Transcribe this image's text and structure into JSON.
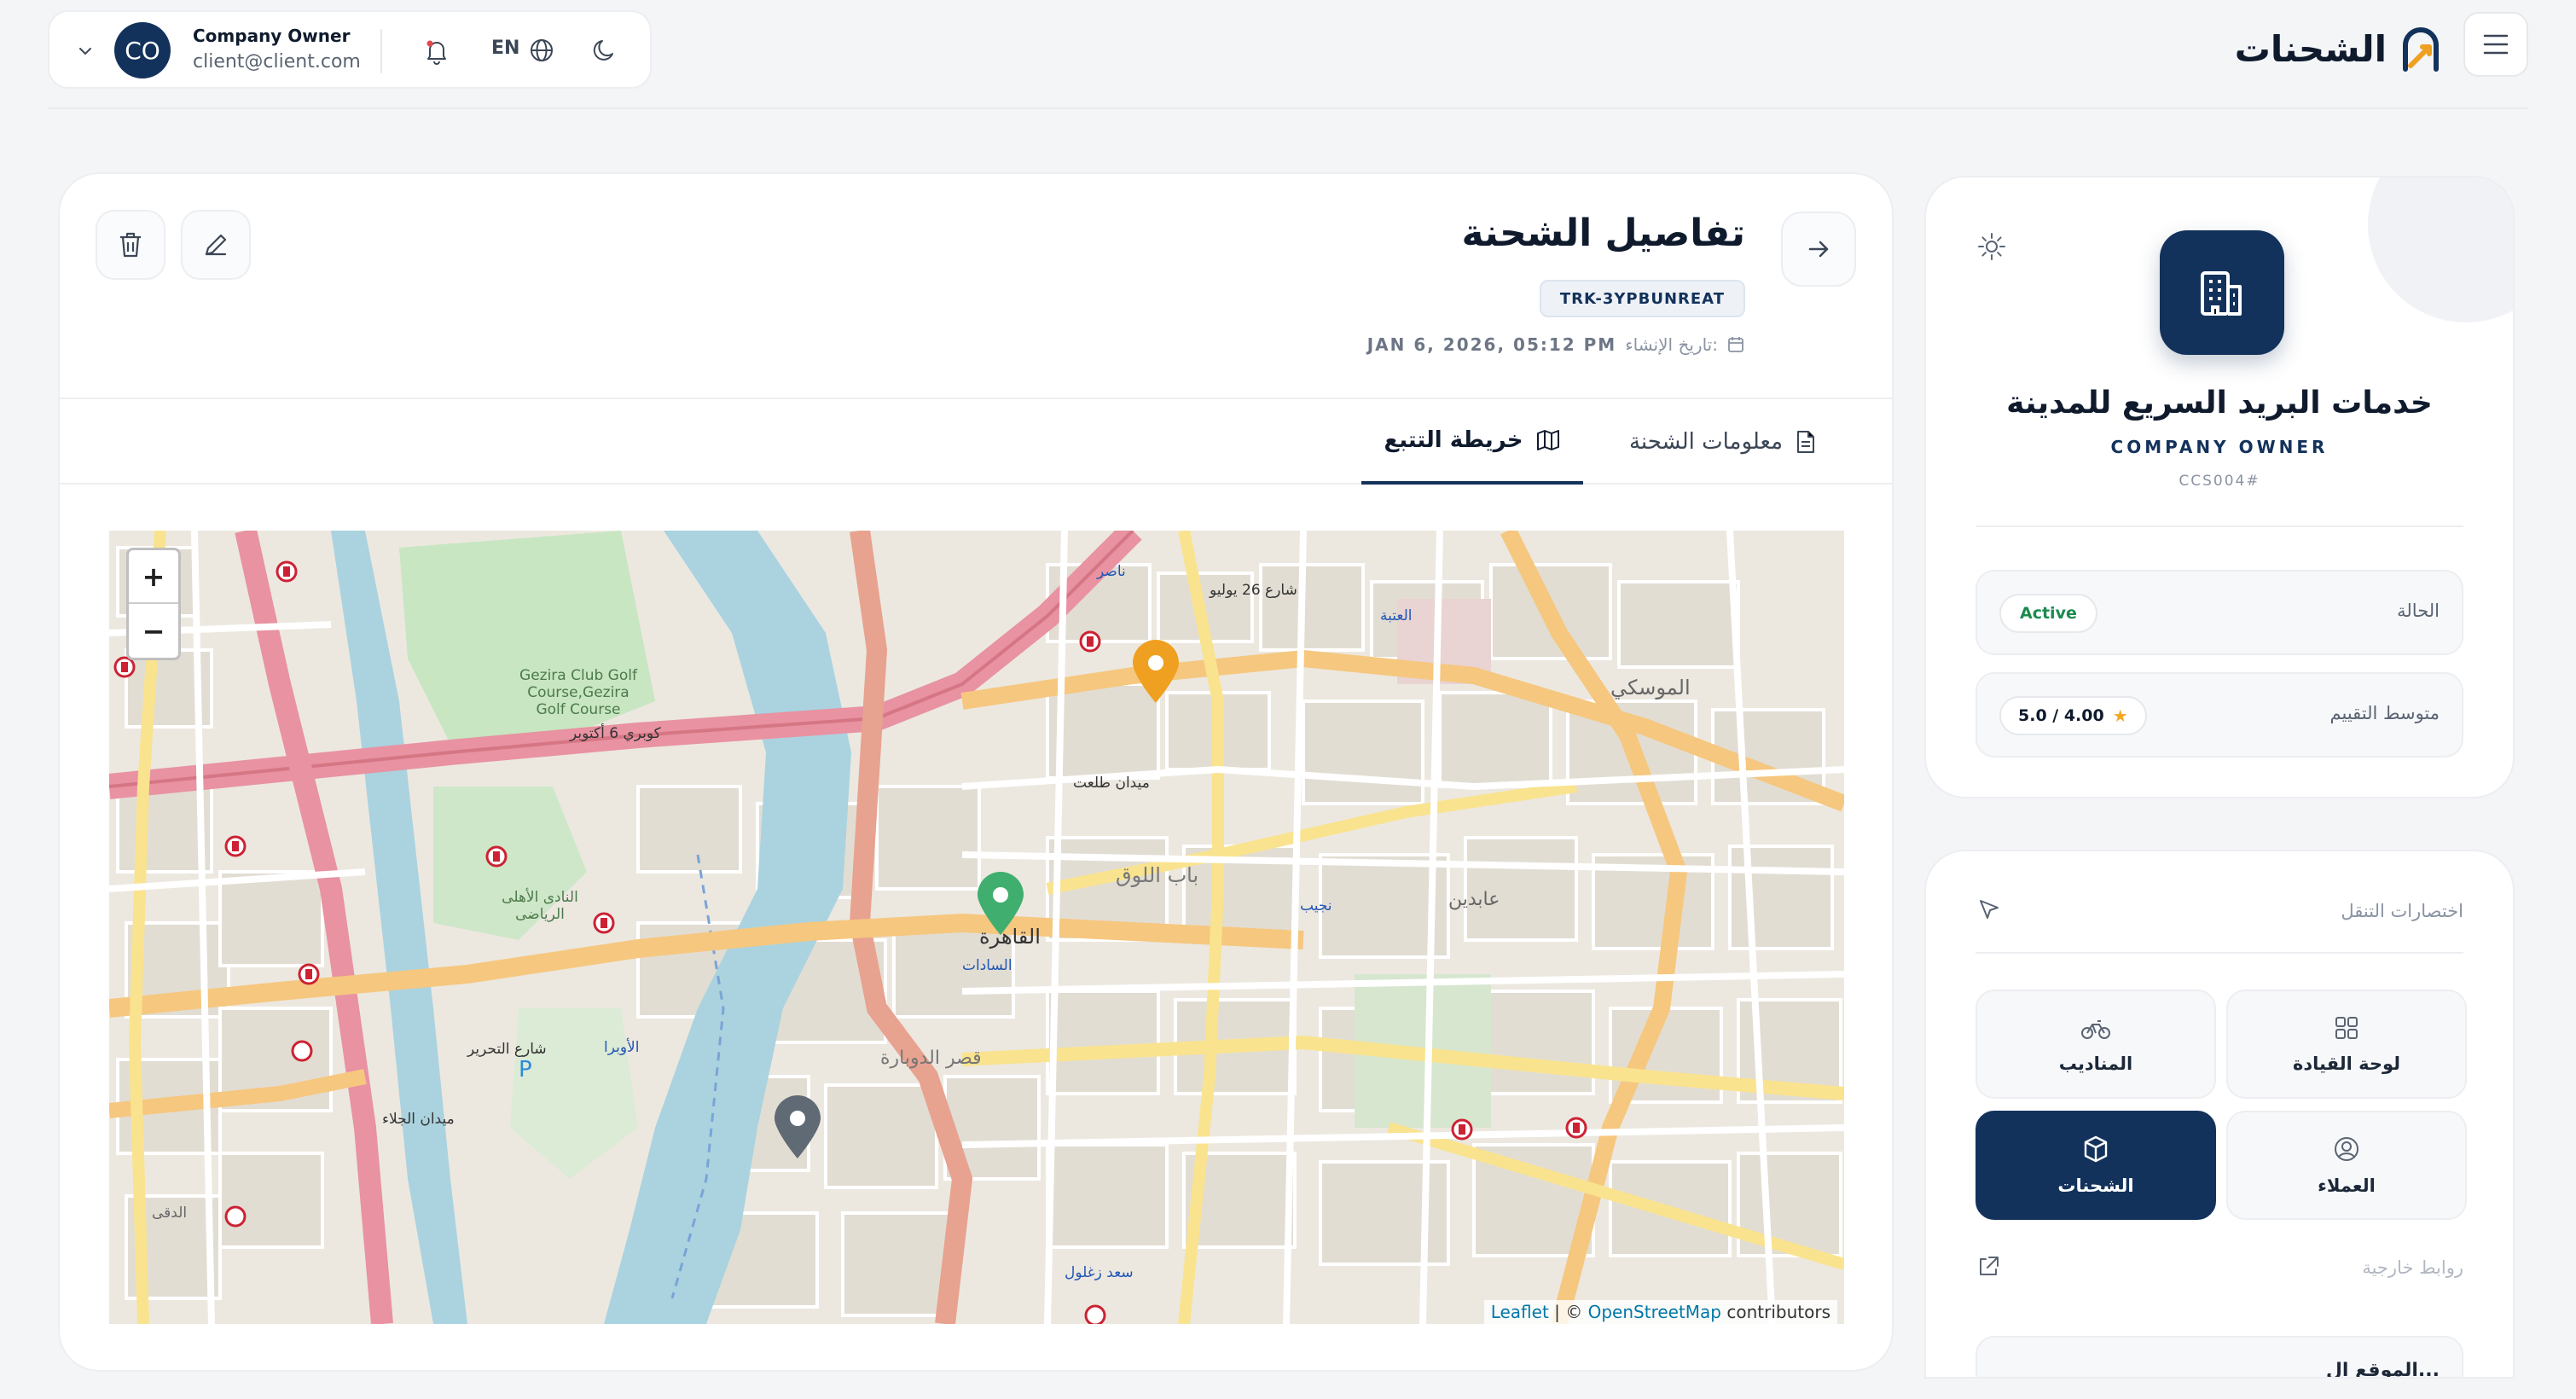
{
  "header": {
    "brand_title": "الشحنات",
    "user": {
      "initials": "CO",
      "name": "Company Owner",
      "email": "client@client.com"
    },
    "language": "EN",
    "icons": [
      "chevron-down-icon",
      "bell-icon",
      "globe-icon",
      "moon-icon",
      "menu-icon"
    ]
  },
  "shipment": {
    "page_title": "تفاصيل الشحنة",
    "tracking_code": "TRK-3YPBUNREAT",
    "created_label": "تاريخ الإنشاء:",
    "created_value": "JAN 6, 2026, 05:12 PM",
    "tabs": [
      {
        "label": "معلومات الشحنة",
        "icon": "document-icon",
        "active": false
      },
      {
        "label": "خريطة التتبع",
        "icon": "map-icon",
        "active": true
      }
    ]
  },
  "map": {
    "zoom_in": "+",
    "zoom_out": "−",
    "attribution": {
      "leaflet": "Leaflet",
      "separator": " | © ",
      "osm": "OpenStreetMap",
      "suffix": " contributors"
    },
    "labels": [
      "Gezira Club Golf Course,Gezira Golf Course",
      "القاهرة",
      "كوبري 6 أكتوبر",
      "ميدان طلعت",
      "عابدين",
      "الموسكي",
      "باب اللوق",
      "السادات",
      "الأوبرا",
      "نجيب",
      "العتبة",
      "سعد زغلول",
      "ناصر",
      "قصر الدوبارة",
      "النادى الأهلى الرياضى",
      "شارع 26 يوليو",
      "شارع التحرير",
      "ميدان الجلاء",
      "الدقى"
    ],
    "markers": [
      {
        "name": "origin-marker",
        "color": "#f0a020"
      },
      {
        "name": "current-location-marker",
        "color": "#3fae6e"
      },
      {
        "name": "destination-marker",
        "color": "#606a74"
      }
    ]
  },
  "company": {
    "name": "خدمات البريد السريع للمدينة",
    "role": "COMPANY OWNER",
    "code": "CCS004#",
    "status_label": "الحالة",
    "status_value": "Active",
    "rating_label": "متوسط التقييم",
    "rating_value": "5.0 / 4.00"
  },
  "navigation": {
    "heading": "اختصارات التنقل",
    "items": [
      {
        "label": "لوحة القيادة",
        "icon": "grid-icon",
        "active": false
      },
      {
        "label": "المناديب",
        "icon": "bicycle-icon",
        "active": false
      },
      {
        "label": "العملاء",
        "icon": "user-circle-icon",
        "active": false
      },
      {
        "label": "الشحنات",
        "icon": "box-icon",
        "active": true
      }
    ],
    "external_heading": "روابط خارجية",
    "external_items": [
      {
        "label": "الموقع ال..."
      }
    ]
  },
  "colors": {
    "primary": "#13325b",
    "success": "#1a8a4e",
    "star": "#f5a623",
    "background": "#f4f5f7"
  }
}
